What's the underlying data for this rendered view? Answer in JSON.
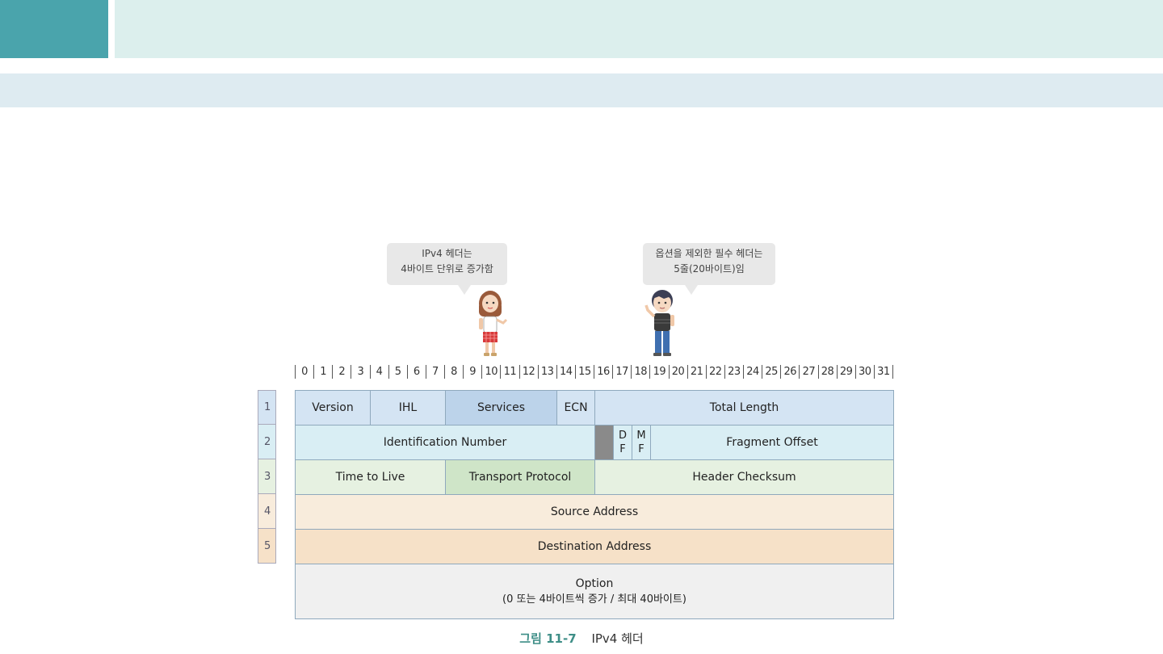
{
  "bubbles": {
    "left": [
      "IPv4 헤더는",
      "4바이트 단위로 증가함"
    ],
    "right": [
      "옵션을 제외한 필수 헤더는",
      "5줄(20바이트)임"
    ]
  },
  "bits": [
    "0",
    "1",
    "2",
    "3",
    "4",
    "5",
    "6",
    "7",
    "8",
    "9",
    "10",
    "11",
    "12",
    "13",
    "14",
    "15",
    "16",
    "17",
    "18",
    "19",
    "20",
    "21",
    "22",
    "23",
    "24",
    "25",
    "26",
    "27",
    "28",
    "29",
    "30",
    "31"
  ],
  "rows": [
    "1",
    "2",
    "3",
    "4",
    "5"
  ],
  "fields": {
    "version": "Version",
    "ihl": "IHL",
    "services": "Services",
    "ecn": "ECN",
    "total_length": "Total Length",
    "identification": "Identification Number",
    "df": "D\nF",
    "mf": "M\nF",
    "fragment_offset": "Fragment Offset",
    "ttl": "Time to Live",
    "transport": "Transport Protocol",
    "checksum": "Header Checksum",
    "source": "Source Address",
    "destination": "Destination Address",
    "option_line1": "Option",
    "option_line2": "(0 또는 4바이트씩 증가 / 최대 40바이트)"
  },
  "caption": {
    "number": "그림 11-7",
    "title": "IPv4 헤더"
  },
  "colors": {
    "accent": "#4aa4ac",
    "caption_number": "#3e8e87"
  }
}
